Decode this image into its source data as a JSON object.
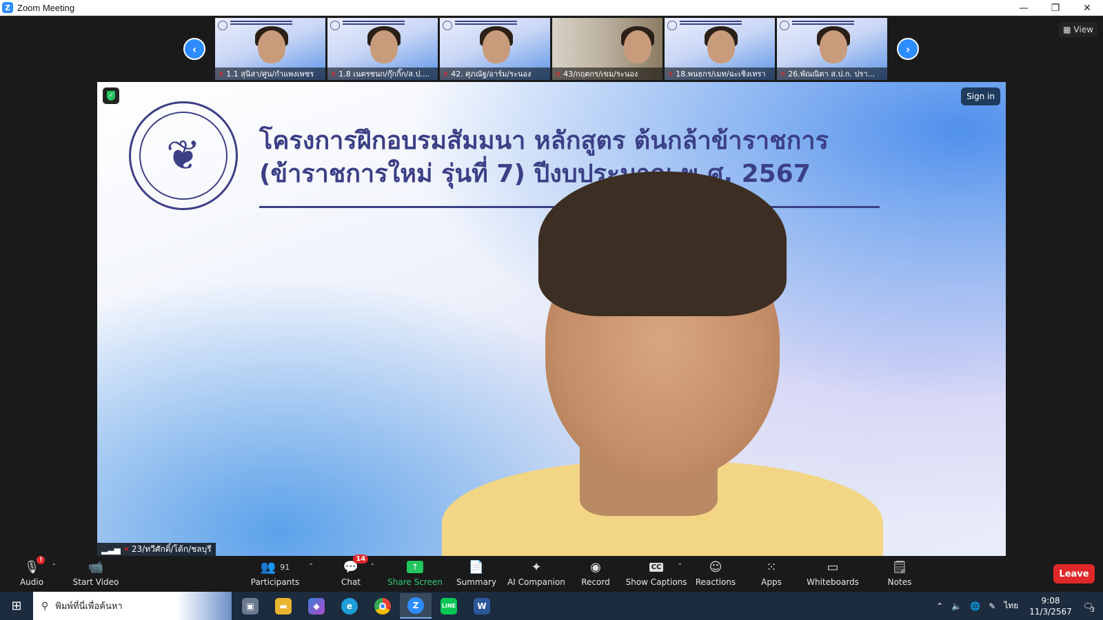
{
  "window": {
    "title": "Zoom Meeting",
    "controls": [
      "—",
      "❐",
      "✕"
    ]
  },
  "thumbnails": [
    {
      "name": "1.1 สุนิสา/ศูน/กำแพงเพชร"
    },
    {
      "name": "1.8 เนตรชนก/กุ๊กกิ๊ก/ส.ป...."
    },
    {
      "name": "42. ศุภณัฐ/อาร์ม/ระนอง"
    },
    {
      "name": "43/กฤตกร/เขม/ระนอง"
    },
    {
      "name": "18.พนธกร/เมท/ฉะเชิงเทรา"
    },
    {
      "name": "26.พัณณิตา ส.ป.ก. ปรา..."
    }
  ],
  "view_label": "View",
  "sign_in_label": "Sign in",
  "slide": {
    "title_line1": "โครงการฝึกอบรมสัมมนา หลักสูตร ต้นกล้าข้าราชการ",
    "title_line2": "(ข้าราชการใหม่ รุ่นที่ 7) ปีงบประมาณ พ.ศ. 2567"
  },
  "active_speaker": "23/ทวีศักดิ์/โต้ก/ชลบุรี",
  "toolbar": {
    "audio": "Audio",
    "audio_alert": "!",
    "start_video": "Start Video",
    "participants": "Participants",
    "participants_count": "91",
    "chat": "Chat",
    "chat_badge": "14",
    "share_screen": "Share Screen",
    "summary": "Summary",
    "ai_companion": "AI Companion",
    "record": "Record",
    "show_captions": "Show Captions",
    "reactions": "Reactions",
    "apps": "Apps",
    "whiteboards": "Whiteboards",
    "notes": "Notes",
    "leave": "Leave"
  },
  "taskbar": {
    "search_placeholder": "พิมพ์ที่นี่เพื่อค้นหา",
    "language": "ไทย",
    "time": "9:08",
    "date": "11/3/2567",
    "notifications": "3"
  },
  "colors": {
    "zoom_blue": "#2d8cff",
    "slide_text": "#3b3f86",
    "share_green": "#23c55e",
    "leave_red": "#e02828"
  }
}
